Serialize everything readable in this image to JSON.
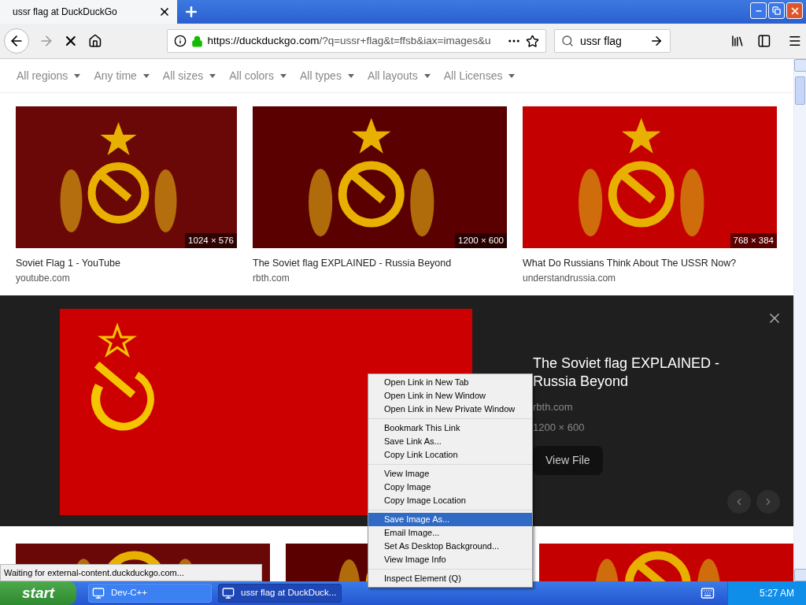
{
  "tab": {
    "title": "ussr flag at DuckDuckGo"
  },
  "address_bar": {
    "url": "https://duckduckgo.com/?q=ussr+flag&t=ffsb&iax=images&u"
  },
  "search_box": {
    "value": "ussr flag"
  },
  "filters": [
    "All regions",
    "Any time",
    "All sizes",
    "All colors",
    "All types",
    "All layouts",
    "All Licenses"
  ],
  "results": [
    {
      "title": "Soviet Flag 1 - YouTube",
      "source": "youtube.com",
      "dimensions": "1024 × 576"
    },
    {
      "title": "The Soviet flag EXPLAINED - Russia Beyond",
      "source": "rbth.com",
      "dimensions": "1200 × 600"
    },
    {
      "title": "What Do Russians Think About The USSR Now?",
      "source": "understandrussia.com",
      "dimensions": "768 × 384"
    }
  ],
  "detail": {
    "title": "The Soviet flag EXPLAINED - Russia Beyond",
    "source": "rbth.com",
    "dimensions": "1200 × 600",
    "button": "View File"
  },
  "more_results": [
    {
      "kind": "picture"
    },
    {
      "kind": "picture"
    },
    {
      "kind": "picture"
    }
  ],
  "context_menu": [
    [
      {
        "label": "Open Link in New Tab",
        "selected": false
      },
      {
        "label": "Open Link in New Window",
        "selected": false
      },
      {
        "label": "Open Link in New Private Window",
        "selected": false
      }
    ],
    [
      {
        "label": "Bookmark This Link",
        "selected": false
      },
      {
        "label": "Save Link As...",
        "selected": false
      },
      {
        "label": "Copy Link Location",
        "selected": false
      }
    ],
    [
      {
        "label": "View Image",
        "selected": false
      },
      {
        "label": "Copy Image",
        "selected": false
      },
      {
        "label": "Copy Image Location",
        "selected": false
      }
    ],
    [
      {
        "label": "Save Image As...",
        "selected": true
      },
      {
        "label": "Email Image...",
        "selected": false
      },
      {
        "label": "Set As Desktop Background...",
        "selected": false
      },
      {
        "label": "View Image Info",
        "selected": false
      }
    ],
    [
      {
        "label": "Inspect Element (Q)",
        "selected": false
      }
    ]
  ],
  "status": "Waiting for external-content.duckduckgo.com...",
  "taskbar": {
    "start": "start",
    "tasks": [
      {
        "label": "Dev-C++",
        "selected": false
      },
      {
        "label": "ussr flag at DuckDuck...",
        "selected": true
      }
    ],
    "clock": "5:27 AM"
  }
}
